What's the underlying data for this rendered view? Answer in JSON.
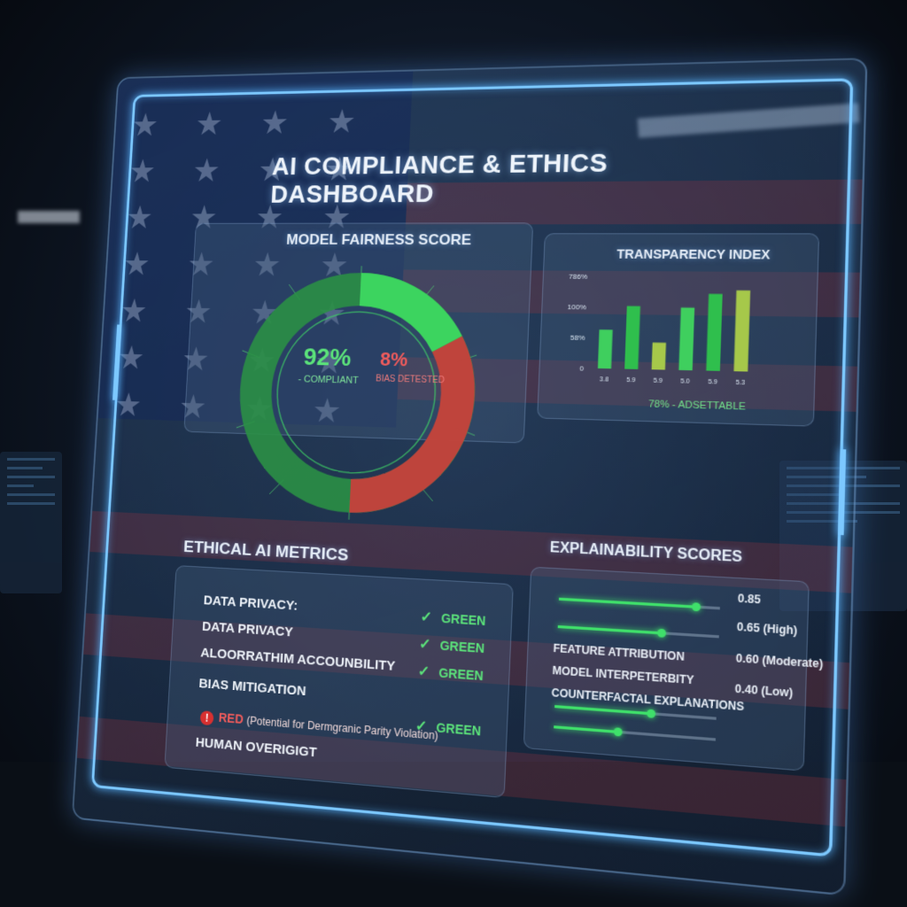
{
  "dashboard": {
    "title": "AI COMPLIANCE & ETHICS DASHBOARD"
  },
  "fairness": {
    "title": "MODEL FAIRNESS SCORE",
    "compliant_value": "92%",
    "compliant_label": "- COMPLIANT",
    "bias_value": "8%",
    "bias_label": "BIAS DETESTED",
    "compliant_color": "#36c25a",
    "bias_color": "#d8373a"
  },
  "transparency": {
    "title": "TRANSPARENCY INDEX",
    "note": "78% - ADSETTABLE"
  },
  "chart_data": {
    "type": "bar",
    "title": "TRANSPARENCY INDEX",
    "y_tick_labels": [
      "786%",
      "100%",
      "58%",
      "0"
    ],
    "categories": [
      "3.8",
      "5.9",
      "5.9",
      "5.0",
      "5.9",
      "5.3"
    ],
    "values": [
      42,
      68,
      29,
      67,
      82,
      86
    ],
    "colors": [
      "#3fcf5e",
      "#2fbf4d",
      "#a6c84a",
      "#3fcf5e",
      "#2fbf4d",
      "#a6c84a"
    ],
    "ylim": [
      0,
      100
    ],
    "annotation": "78% - ADSETTABLE"
  },
  "metrics": {
    "title": "ETHICAL AI METRICS",
    "rows": [
      {
        "label": "DATA PRIVACY:",
        "status": "GREEN"
      },
      {
        "label": "DATA PRIVACY",
        "status": "GREEN"
      },
      {
        "label": "ALOORRATHIM ACCOUNBILITY",
        "status": "GREEN"
      },
      {
        "label": "BIAS MITIGATION",
        "status": ""
      },
      {
        "label": "HUMAN OVERIGIGT",
        "status": "GREEN"
      }
    ],
    "red_flag": {
      "icon": "!",
      "word": "RED",
      "text": "(Potential for Dermgranic Parity Violation)"
    },
    "status_color": "#5be37a"
  },
  "explainability": {
    "title": "EXPLAINABILITY SCORES",
    "values": [
      "0.85",
      "0.65 (High)",
      "0.60 (Moderate)",
      "0.40 (Low)"
    ],
    "labels": [
      "FEATURE ATTRIBUTION",
      "MODEL INTERPETERBITY",
      "COUNTERFACTAL EXPLANATIONS"
    ],
    "slider_levels": [
      0.85,
      0.65,
      0.6,
      0.4
    ],
    "accent_color": "#3fe06a"
  }
}
